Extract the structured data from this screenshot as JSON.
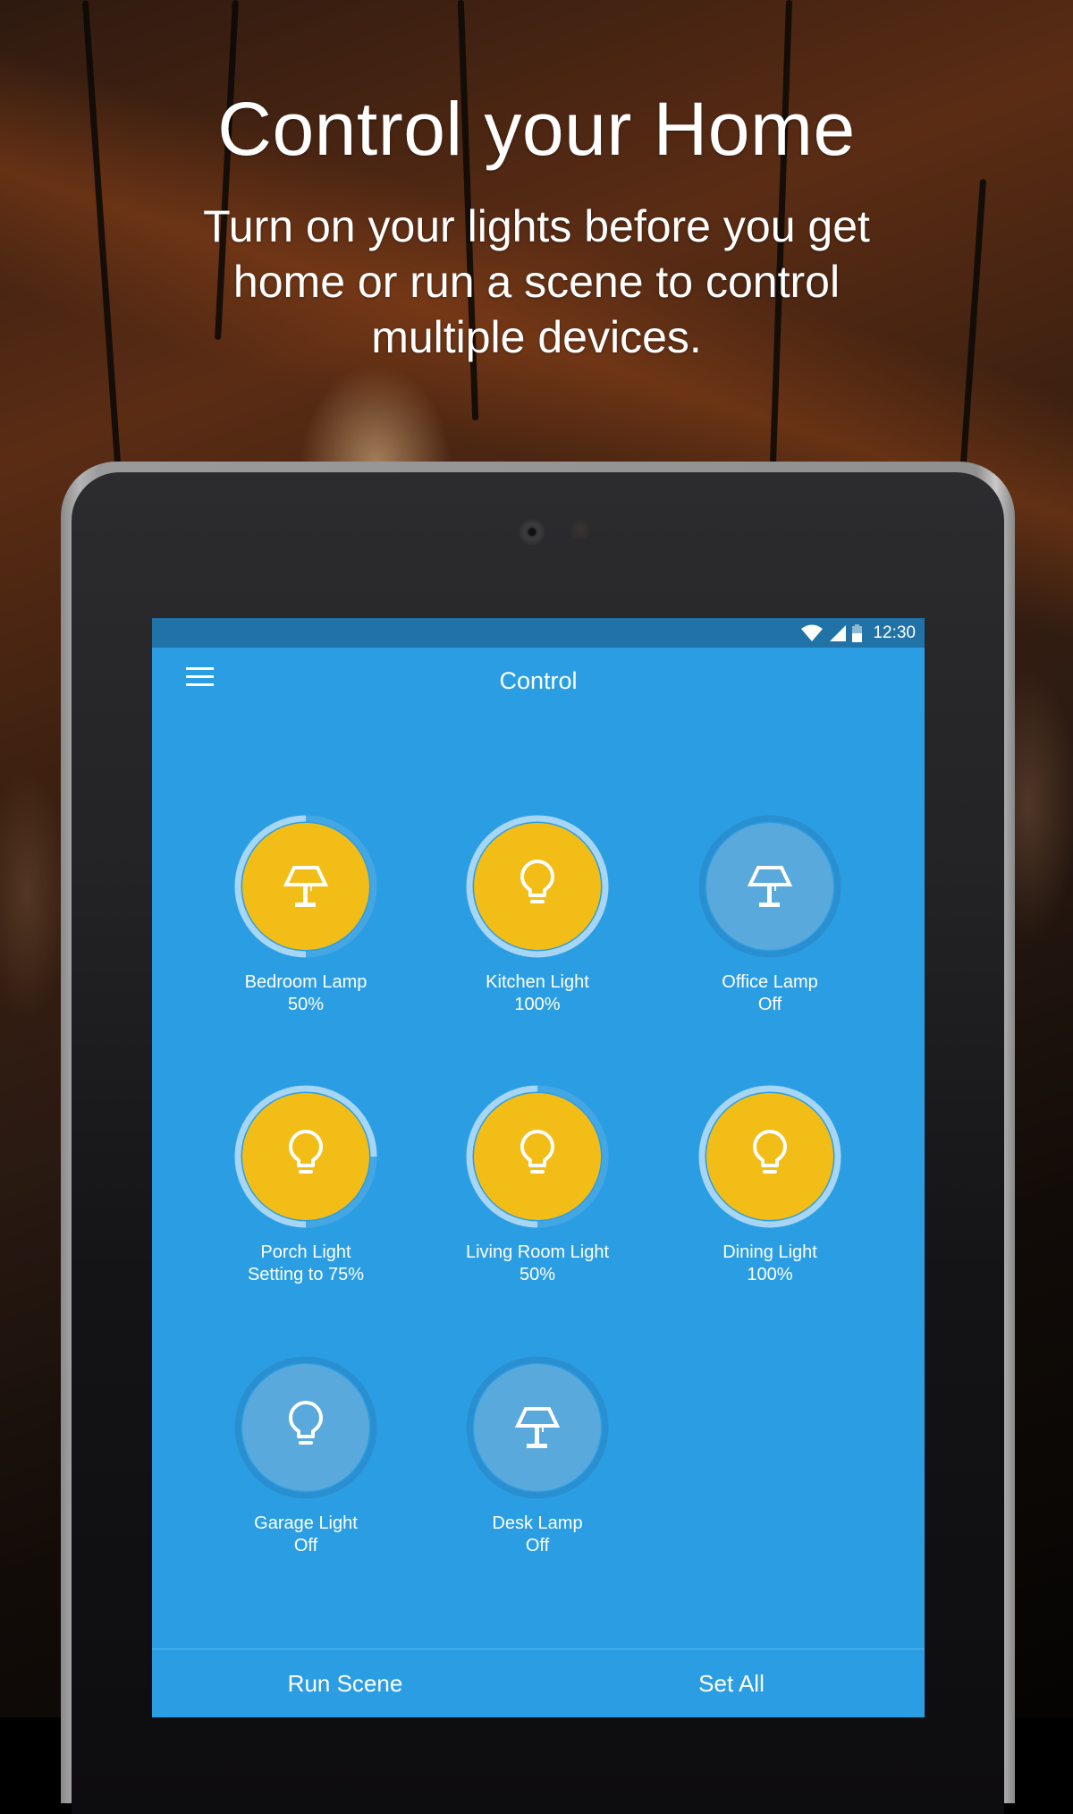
{
  "promo": {
    "headline": "Control your Home",
    "subhead": "Turn on your lights before you get home or run a scene to control multiple devices."
  },
  "status_bar": {
    "time": "12:30",
    "icons": [
      "wifi-icon",
      "signal-icon",
      "battery-icon"
    ]
  },
  "app_bar": {
    "title": "Control",
    "menu_icon": "hamburger-menu-icon"
  },
  "colors": {
    "screen_bg": "#2b9ee3",
    "status_bar_bg": "#2172a6",
    "on_fill": "#f2bd16",
    "off_fill": "#5aa9dc",
    "ring_active": "#a6d6f3",
    "ring_track": "#2a8fd0"
  },
  "devices": [
    {
      "name": "Bedroom Lamp",
      "state": "50%",
      "icon": "lamp-icon",
      "on": true,
      "level": 0.5
    },
    {
      "name": "Kitchen Light",
      "state": "100%",
      "icon": "bulb-icon",
      "on": true,
      "level": 1.0
    },
    {
      "name": "Office Lamp",
      "state": "Off",
      "icon": "lamp-icon",
      "on": false,
      "level": 0
    },
    {
      "name": "Porch Light",
      "state": "Setting to 75%",
      "icon": "bulb-icon",
      "on": true,
      "level": 0.75
    },
    {
      "name": "Living Room Light",
      "state": "50%",
      "icon": "bulb-icon",
      "on": true,
      "level": 0.5
    },
    {
      "name": "Dining Light",
      "state": "100%",
      "icon": "bulb-icon",
      "on": true,
      "level": 1.0
    },
    {
      "name": "Garage Light",
      "state": "Off",
      "icon": "bulb-icon",
      "on": false,
      "level": 0
    },
    {
      "name": "Desk Lamp",
      "state": "Off",
      "icon": "lamp-icon",
      "on": false,
      "level": 0
    }
  ],
  "bottom_actions": {
    "run_scene": "Run Scene",
    "set_all": "Set All"
  }
}
